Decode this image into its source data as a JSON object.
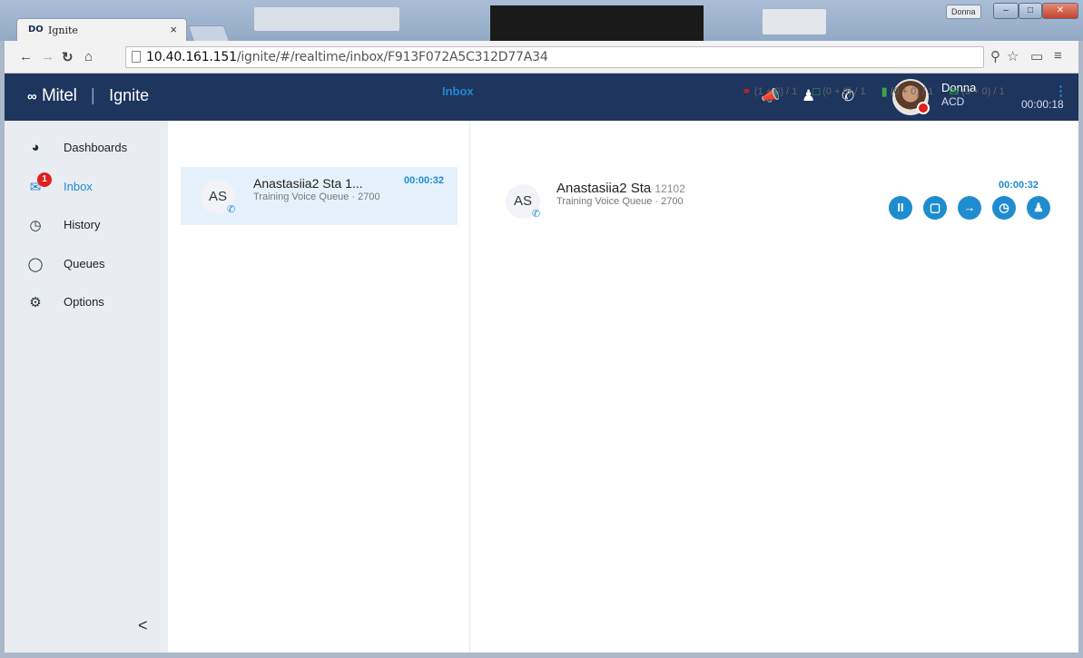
{
  "browser": {
    "tab_title": "Ignite",
    "tab_logo": "DO",
    "tab_close": "×",
    "user_chip": "Donna",
    "url_host": "10.40.161.151",
    "url_path": "/ignite/#/realtime/inbox/F913F072A5C312D77A34",
    "icons": [
      "back-icon",
      "forward-icon",
      "reload-icon",
      "home-icon",
      "page-icon",
      "key-icon",
      "star-icon",
      "cast-icon",
      "menu-icon"
    ]
  },
  "appbar": {
    "brand": "Mitel",
    "product": "Ignite",
    "agent_name": "Donna",
    "agent_mode": "ACD",
    "agent_timer": "00:00:18"
  },
  "sidebar": {
    "items": [
      {
        "label": "Dashboards",
        "icon": "gauge-icon"
      },
      {
        "label": "Inbox",
        "icon": "inbox-icon",
        "badge": "1"
      },
      {
        "label": "History",
        "icon": "clock-icon"
      },
      {
        "label": "Queues",
        "icon": "queue-icon"
      },
      {
        "label": "Options",
        "icon": "gear-icon"
      }
    ],
    "collapse": "<"
  },
  "inbox": {
    "title": "Inbox",
    "counters": [
      {
        "icon": "headset-icon",
        "text": "(1 + 0) / 1",
        "color": "#e0201f"
      },
      {
        "icon": "chat-icon",
        "text": "(0 + 0) / 1",
        "color": "#3aa845"
      },
      {
        "icon": "mobile-icon",
        "text": "(0 + 0) / 1",
        "color": "#3aa845"
      },
      {
        "icon": "email-icon",
        "text": "(0 + 0) / 1",
        "color": "#3aa845"
      }
    ]
  },
  "list": {
    "item": {
      "initials": "AS",
      "name": "Anastasiia2 Sta 1...",
      "queue": "Training Voice Queue · 2700",
      "timer": "00:00:32"
    }
  },
  "detail": {
    "initials": "AS",
    "name": "Anastasiia2 Sta",
    "ext": "12102",
    "queue": "Training Voice Queue · 2700",
    "timer": "00:00:32",
    "actions": [
      "pause-icon",
      "stop-icon",
      "transfer-icon",
      "schedule-icon",
      "conference-icon"
    ]
  },
  "colors": {
    "appbar": "#1e355e",
    "accent": "#1f8ccf",
    "alert": "#e0201f"
  }
}
